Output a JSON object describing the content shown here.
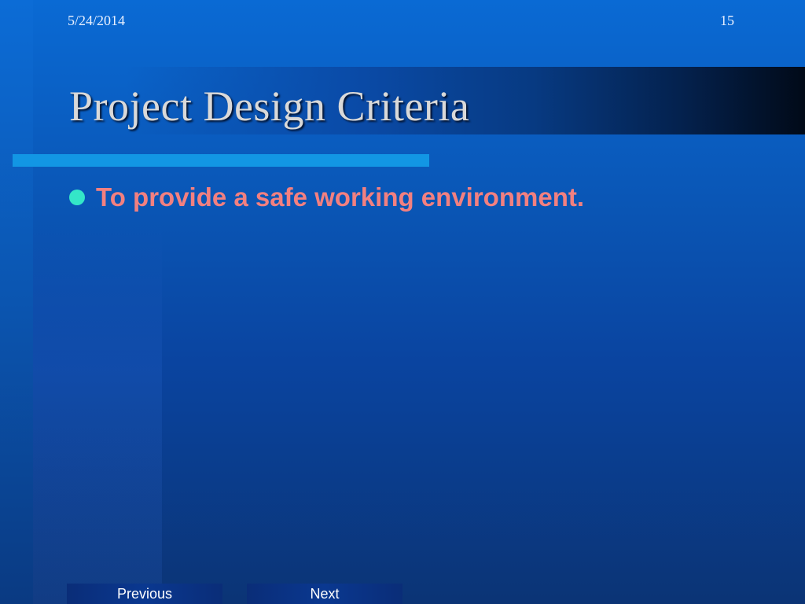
{
  "header": {
    "date": "5/24/2014",
    "page_number": "15"
  },
  "slide": {
    "title": "Project Design Criteria",
    "bullets": [
      {
        "text": "To provide a safe working environment."
      }
    ]
  },
  "nav": {
    "previous_label": "Previous",
    "next_label": "Next"
  },
  "colors": {
    "title": "#d9d9d9",
    "bullet_text": "#f28080",
    "bullet_dot": "#34e6c8",
    "accent_bar": "#1296e4"
  }
}
